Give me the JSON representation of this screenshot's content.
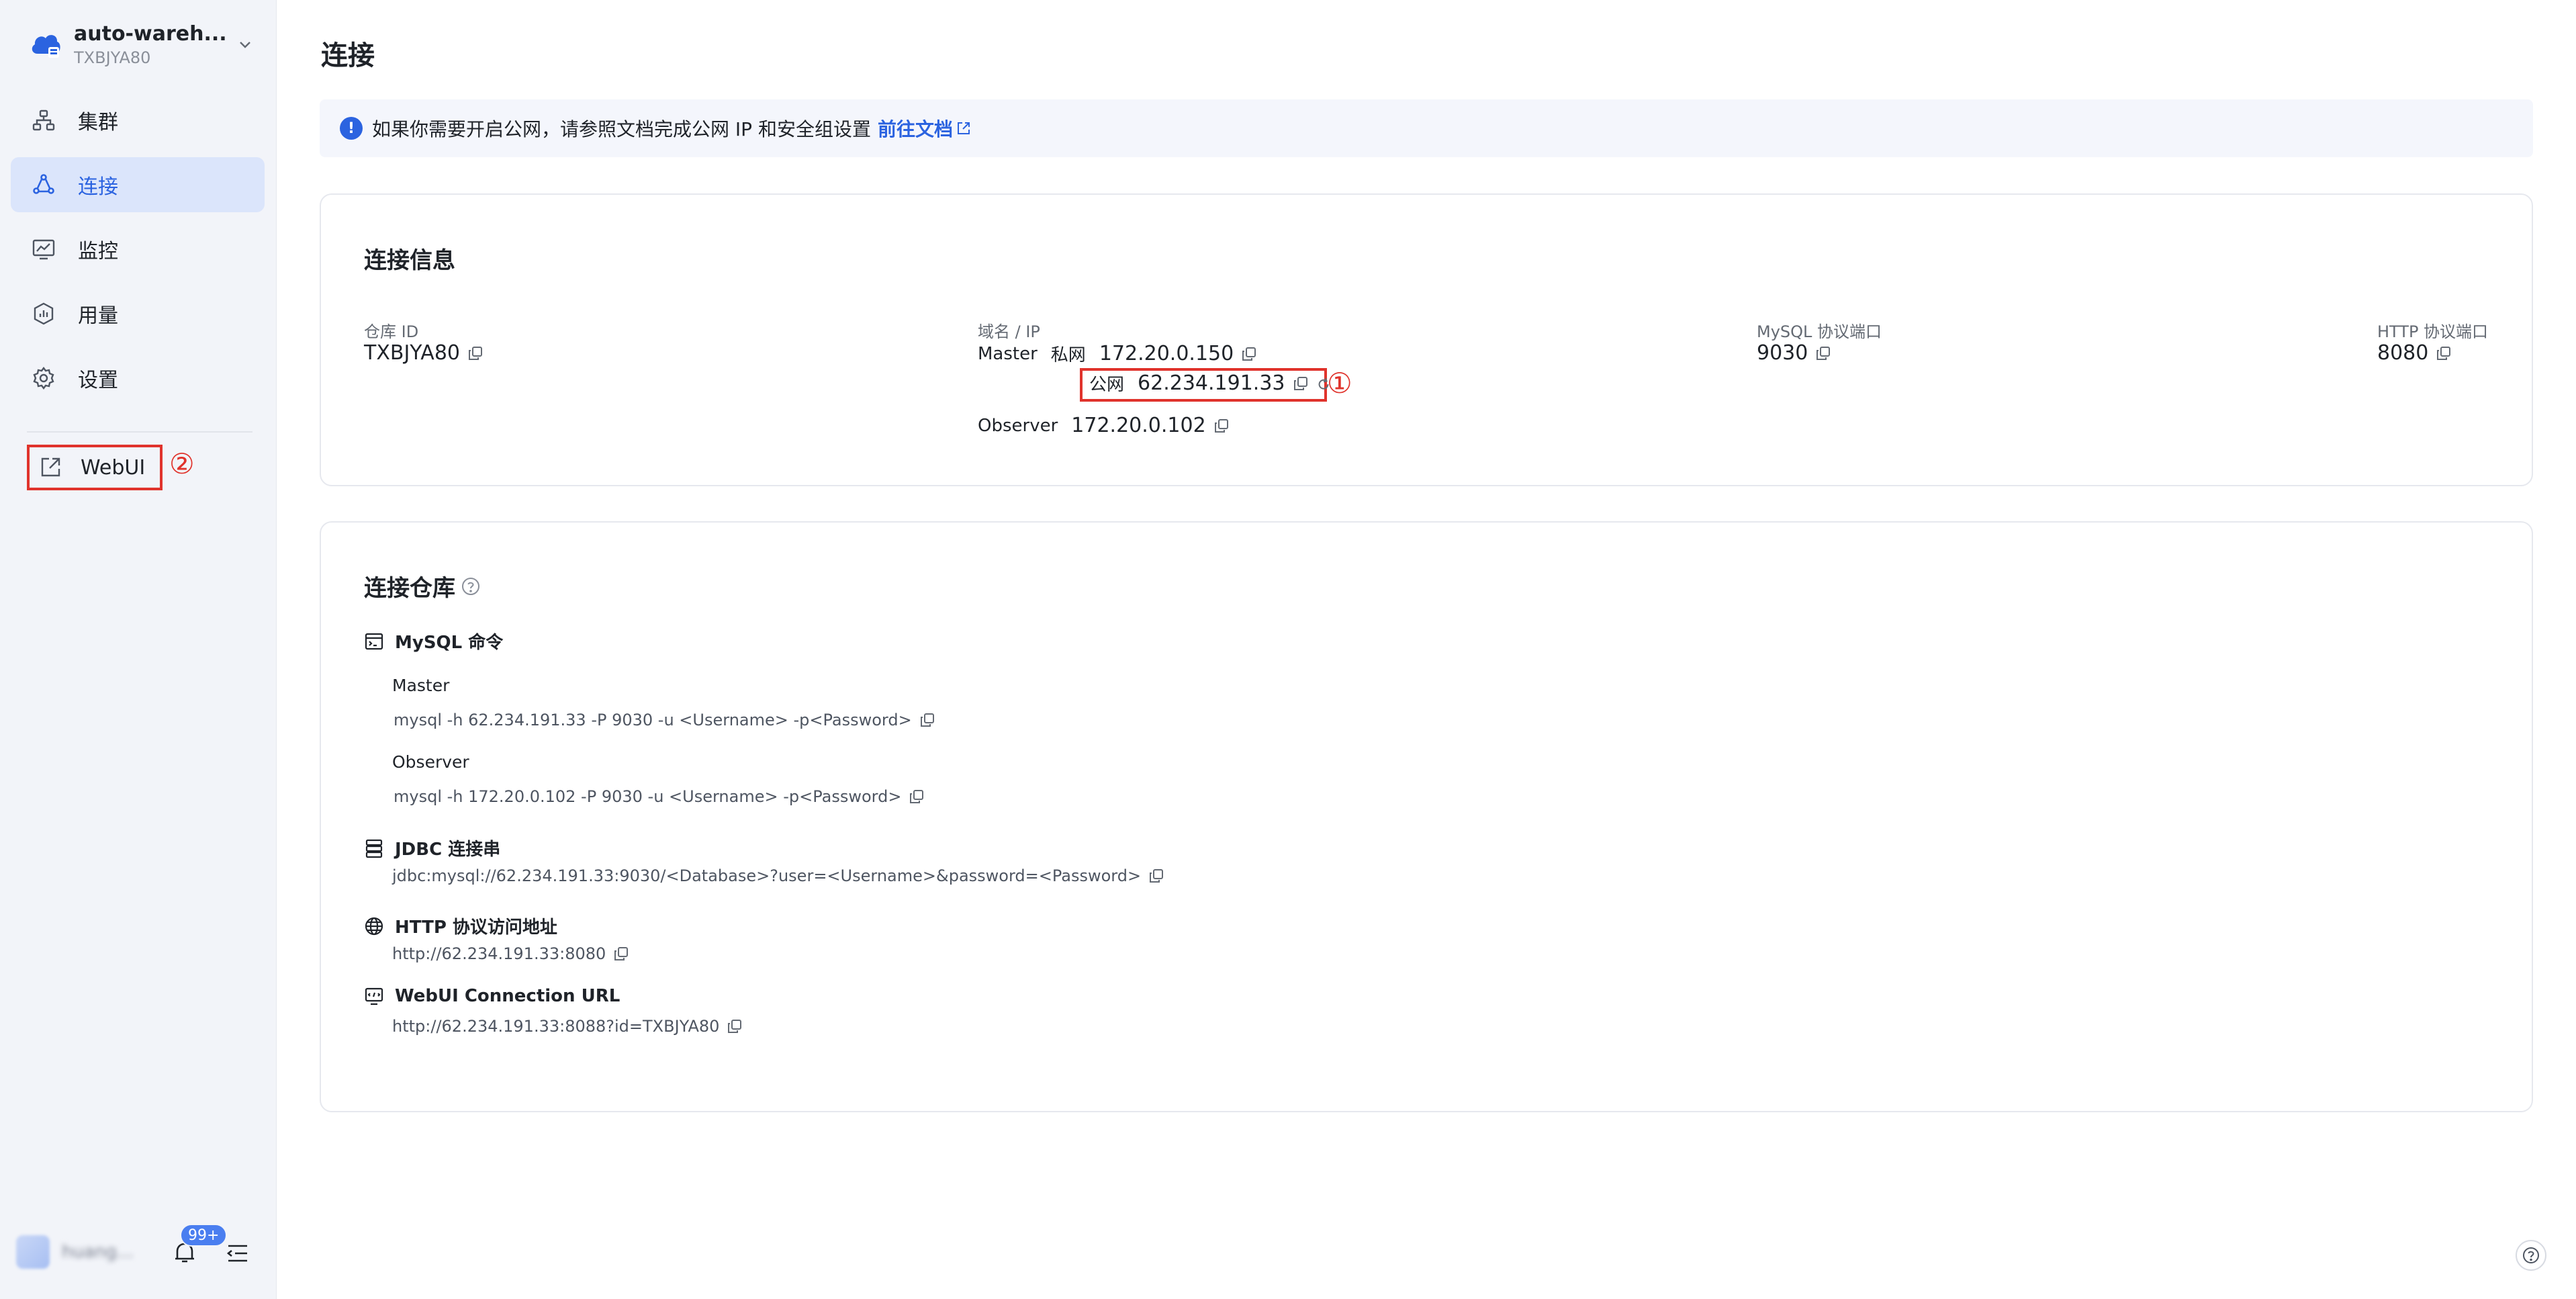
{
  "workspace": {
    "name": "auto-wareh...",
    "id": "TXBJYA80"
  },
  "sidebar": {
    "items": [
      {
        "label": "集群",
        "icon": "cluster-icon"
      },
      {
        "label": "连接",
        "icon": "connection-icon",
        "active": true
      },
      {
        "label": "监控",
        "icon": "monitor-icon"
      },
      {
        "label": "用量",
        "icon": "usage-icon"
      },
      {
        "label": "设置",
        "icon": "settings-icon"
      }
    ],
    "webui_label": "WebUI",
    "webui_marker": "②",
    "user_name": "huang...",
    "notification_badge": "99+"
  },
  "page": {
    "title": "连接"
  },
  "notice": {
    "text": "如果你需要开启公网，请参照文档完成公网 IP 和安全组设置",
    "link": "前往文档"
  },
  "connection_info": {
    "title": "连接信息",
    "warehouse_id_label": "仓库 ID",
    "warehouse_id": "TXBJYA80",
    "domain_label": "域名 / IP",
    "master_label": "Master",
    "private_label": "私网",
    "private_ip": "172.20.0.150",
    "public_label": "公网",
    "public_ip": "62.234.191.33",
    "public_marker": "①",
    "observer_label": "Observer",
    "observer_ip": "172.20.0.102",
    "mysql_port_label": "MySQL 协议端口",
    "mysql_port": "9030",
    "http_port_label": "HTTP 协议端口",
    "http_port": "8080"
  },
  "connect_warehouse": {
    "title": "连接仓库",
    "mysql_head": "MySQL 命令",
    "master_label": "Master",
    "master_cmd": "mysql -h 62.234.191.33 -P 9030 -u <Username> -p<Password>",
    "observer_label": "Observer",
    "observer_cmd": "mysql -h 172.20.0.102 -P 9030 -u <Username> -p<Password>",
    "jdbc_head": "JDBC 连接串",
    "jdbc_value": "jdbc:mysql://62.234.191.33:9030/<Database>?user=<Username>&password=<Password>",
    "http_head": "HTTP 协议访问地址",
    "http_value": "http://62.234.191.33:8080",
    "webui_head": "WebUI Connection URL",
    "webui_value": "http://62.234.191.33:8088?id=TXBJYA80"
  },
  "colors": {
    "accent": "#2b63e0",
    "highlight": "#e0332c",
    "sidebar_bg": "#f2f4f9"
  }
}
